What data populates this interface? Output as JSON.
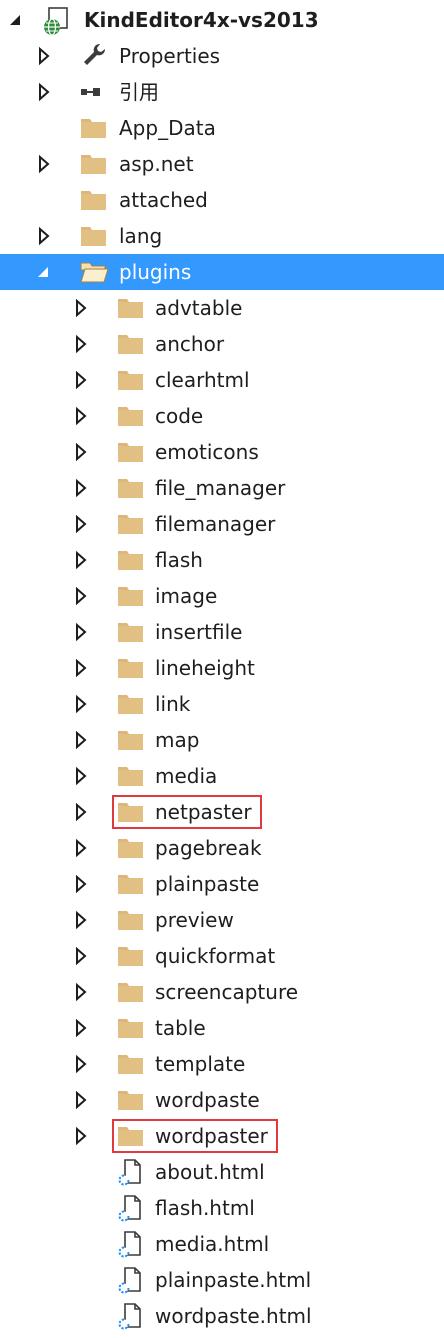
{
  "solution_explorer": {
    "project": {
      "name": "KindEditor4x-vs2013",
      "icon": "web-project-icon",
      "state": "expanded"
    },
    "items": [
      {
        "label": "Properties",
        "icon": "wrench-icon",
        "toggle": "collapsed"
      },
      {
        "label": "引用",
        "icon": "references-icon",
        "toggle": "collapsed"
      },
      {
        "label": "App_Data",
        "icon": "folder-icon",
        "toggle": "none"
      },
      {
        "label": "asp.net",
        "icon": "folder-icon",
        "toggle": "collapsed"
      },
      {
        "label": "attached",
        "icon": "folder-icon",
        "toggle": "none"
      },
      {
        "label": "lang",
        "icon": "folder-icon",
        "toggle": "collapsed"
      },
      {
        "label": "plugins",
        "icon": "folder-open-icon",
        "toggle": "expanded",
        "selected": true
      },
      {
        "label": "advtable",
        "icon": "folder-icon",
        "toggle": "collapsed"
      },
      {
        "label": "anchor",
        "icon": "folder-icon",
        "toggle": "collapsed"
      },
      {
        "label": "clearhtml",
        "icon": "folder-icon",
        "toggle": "collapsed"
      },
      {
        "label": "code",
        "icon": "folder-icon",
        "toggle": "collapsed"
      },
      {
        "label": "emoticons",
        "icon": "folder-icon",
        "toggle": "collapsed"
      },
      {
        "label": "file_manager",
        "icon": "folder-icon",
        "toggle": "collapsed"
      },
      {
        "label": "filemanager",
        "icon": "folder-icon",
        "toggle": "collapsed"
      },
      {
        "label": "flash",
        "icon": "folder-icon",
        "toggle": "collapsed"
      },
      {
        "label": "image",
        "icon": "folder-icon",
        "toggle": "collapsed"
      },
      {
        "label": "insertfile",
        "icon": "folder-icon",
        "toggle": "collapsed"
      },
      {
        "label": "lineheight",
        "icon": "folder-icon",
        "toggle": "collapsed"
      },
      {
        "label": "link",
        "icon": "folder-icon",
        "toggle": "collapsed"
      },
      {
        "label": "map",
        "icon": "folder-icon",
        "toggle": "collapsed"
      },
      {
        "label": "media",
        "icon": "folder-icon",
        "toggle": "collapsed"
      },
      {
        "label": "netpaster",
        "icon": "folder-icon",
        "toggle": "collapsed",
        "highlighted": true
      },
      {
        "label": "pagebreak",
        "icon": "folder-icon",
        "toggle": "collapsed"
      },
      {
        "label": "plainpaste",
        "icon": "folder-icon",
        "toggle": "collapsed"
      },
      {
        "label": "preview",
        "icon": "folder-icon",
        "toggle": "collapsed"
      },
      {
        "label": "quickformat",
        "icon": "folder-icon",
        "toggle": "collapsed"
      },
      {
        "label": "screencapture",
        "icon": "folder-icon",
        "toggle": "collapsed"
      },
      {
        "label": "table",
        "icon": "folder-icon",
        "toggle": "collapsed"
      },
      {
        "label": "template",
        "icon": "folder-icon",
        "toggle": "collapsed"
      },
      {
        "label": "wordpaste",
        "icon": "folder-icon",
        "toggle": "collapsed"
      },
      {
        "label": "wordpaster",
        "icon": "folder-icon",
        "toggle": "collapsed",
        "highlighted": true
      },
      {
        "label": "about.html",
        "icon": "html-file-icon",
        "toggle": "none"
      },
      {
        "label": "flash.html",
        "icon": "html-file-icon",
        "toggle": "none"
      },
      {
        "label": "media.html",
        "icon": "html-file-icon",
        "toggle": "none"
      },
      {
        "label": "plainpaste.html",
        "icon": "html-file-icon",
        "toggle": "none"
      },
      {
        "label": "wordpaste.html",
        "icon": "html-file-icon",
        "toggle": "none"
      }
    ]
  },
  "colors": {
    "selection": "#3399ff",
    "folder": "#dcb67a",
    "highlight_border": "#e0393e",
    "text": "#1e1e1e"
  }
}
